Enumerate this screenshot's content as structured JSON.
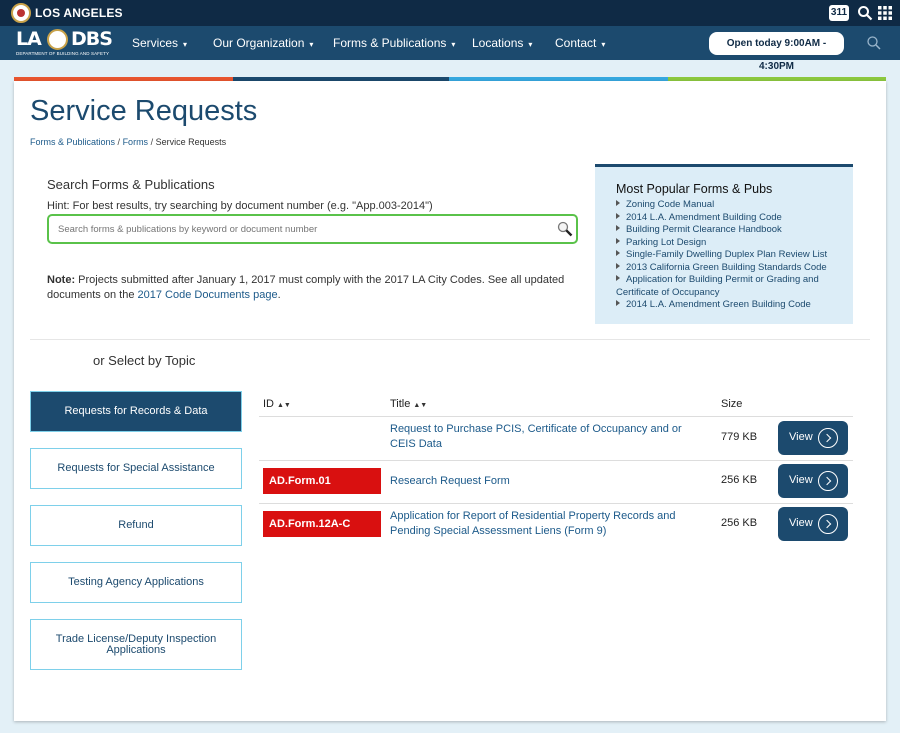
{
  "topbar": {
    "city": "LOS ANGELES",
    "badge": "311"
  },
  "logo": {
    "left": "LA",
    "right": "DBS",
    "subtitle": "DEPARTMENT OF BUILDING AND SAFETY"
  },
  "nav": {
    "items": [
      "Services",
      "Our Organization",
      "Forms & Publications",
      "Locations",
      "Contact"
    ],
    "open_label": "Open today 9:00AM - 4:30PM"
  },
  "page": {
    "title": "Service Requests",
    "breadcrumb": [
      "Forms & Publications",
      "Forms",
      "Service Requests"
    ]
  },
  "search": {
    "heading": "Search Forms & Publications",
    "hint_label": "Hint:",
    "hint_text": " For best results, try searching by document number (e.g. \"App.003-2014\")",
    "placeholder": "Search forms & publications by keyword or document number"
  },
  "note": {
    "label": "Note:",
    "text": " Projects submitted after January 1, 2017 must comply with the 2017 LA City Codes. See all updated documents on the ",
    "link": "2017 Code Documents page",
    "end": "."
  },
  "popular": {
    "heading": "Most Popular Forms & Pubs",
    "items": [
      "Zoning Code Manual",
      "2014 L.A. Amendment Building Code",
      "Building Permit Clearance Handbook",
      "Parking Lot Design",
      "Single-Family Dwelling Duplex Plan Review List",
      "2013 California Green Building Standards Code",
      "Application for Building Permit or Grading and Certificate of Occupancy",
      "2014 L.A. Amendment Green Building Code"
    ]
  },
  "topics": {
    "heading": "or Select by Topic",
    "items": [
      "Requests for Records & Data",
      "Requests for Special Assistance",
      "Refund",
      "Testing Agency Applications",
      "Trade License/Deputy Inspection Applications"
    ]
  },
  "table": {
    "headers": {
      "id": "ID",
      "title": "Title",
      "size": "Size"
    },
    "view_label": "View",
    "rows": [
      {
        "id": "",
        "title": "Request to Purchase PCIS, Certificate of Occupancy and or CEIS Data",
        "size": "779 KB"
      },
      {
        "id": "AD.Form.01",
        "title": "Research Request Form",
        "size": "256 KB"
      },
      {
        "id": "AD.Form.12A-C",
        "title": "Application for Report of Residential Property Records and Pending Special Assessment Liens (Form 9)",
        "size": "256 KB"
      }
    ]
  },
  "colors": {
    "navy": "#0f2a45",
    "nav_blue": "#1c4a6e",
    "stripe": [
      "#e8552f",
      "#1c4a6e",
      "#37a8df",
      "#8cc83f"
    ],
    "id_red": "#d91010",
    "search_border": "#5ac24a"
  }
}
